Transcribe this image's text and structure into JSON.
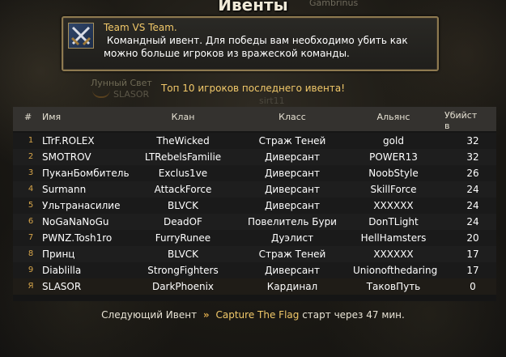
{
  "window": {
    "title": "Ивенты",
    "background_label": "Gambrinus"
  },
  "event_info": {
    "icon": "crossed-swords-icon",
    "name": "Team VS Team.",
    "description": " Командный ивент. Для победы вам необходимо убить как можно больше игроков из вражеской команды."
  },
  "background_text": {
    "guild": "Лунный Свет",
    "guild_sub": "SLASOR",
    "ghost": "sirt11"
  },
  "leaderboard": {
    "title": "Топ 10 игроков последнего ивента!",
    "columns": {
      "num": "#",
      "name": "Имя",
      "clan": "Клан",
      "class": "Класс",
      "alliance": "Альянс",
      "kills": "Убийст\nв"
    },
    "rows": [
      {
        "num": "1",
        "name": "LTrF.ROLEX",
        "clan": "TheWicked",
        "class": "Страж Теней",
        "alliance": "gold",
        "kills": "32"
      },
      {
        "num": "2",
        "name": "SMOTROV",
        "clan": "LTRebelsFamilie",
        "class": "Диверсант",
        "alliance": "POWER13",
        "kills": "32"
      },
      {
        "num": "3",
        "name": "ПуканБомбитель",
        "clan": "Exclus1ve",
        "class": "Диверсант",
        "alliance": "NoobStyle",
        "kills": "26"
      },
      {
        "num": "4",
        "name": "Surmann",
        "clan": "AttackForce",
        "class": "Диверсант",
        "alliance": "SkillForce",
        "kills": "24"
      },
      {
        "num": "5",
        "name": "Ультранасилие",
        "clan": "BLVCK",
        "class": "Диверсант",
        "alliance": "XXXXXX",
        "kills": "24"
      },
      {
        "num": "6",
        "name": "NoGaNaNoGu",
        "clan": "DeadOF",
        "class": "Повелитель Бури",
        "alliance": "DonTLight",
        "kills": "24"
      },
      {
        "num": "7",
        "name": "PWNZ.Tosh1ro",
        "clan": "FurryRunee",
        "class": "Дуэлист",
        "alliance": "HellHamsters",
        "kills": "20"
      },
      {
        "num": "8",
        "name": "Принц",
        "clan": "BLVCK",
        "class": "Страж Теней",
        "alliance": "XXXXXX",
        "kills": "17"
      },
      {
        "num": "9",
        "name": "Diablilla",
        "clan": "StrongFighters",
        "class": "Диверсант",
        "alliance": "Unionofthedaring",
        "kills": "17"
      },
      {
        "num": "Я",
        "name": "SLASOR",
        "clan": "DarkPhoenix",
        "class": "Кардинал",
        "alliance": "ТаковПуть",
        "kills": "0"
      }
    ]
  },
  "footer": {
    "prefix": "Следующий Ивент",
    "arrow": "»",
    "event_name": "Capture The Flag",
    "suffix": "старт через 47 мин."
  },
  "colors": {
    "accent": "#f2c96a",
    "number": "#d8a64a",
    "header_bg": "#34322f"
  }
}
